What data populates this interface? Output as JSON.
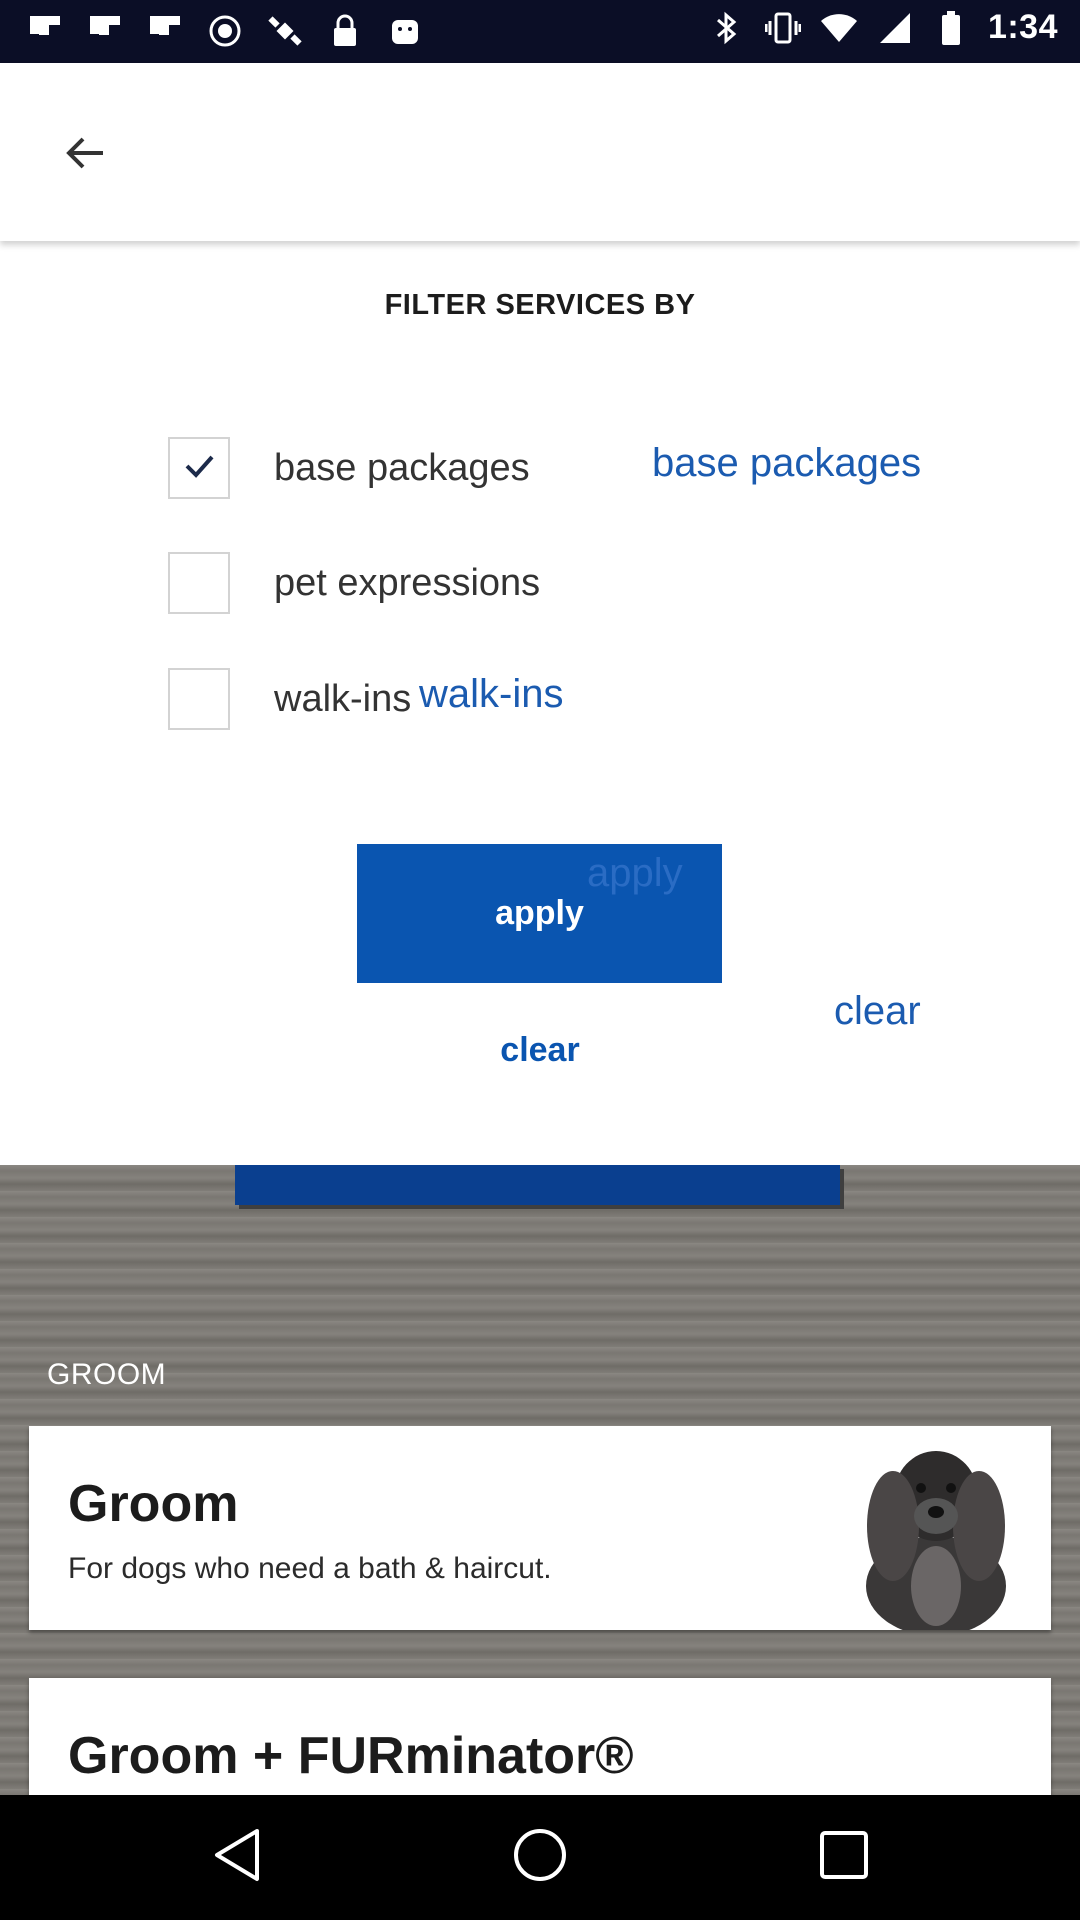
{
  "status_bar": {
    "time": "1:34",
    "icons": [
      "flipboard-icon",
      "flipboard-icon",
      "flipboard-icon",
      "circle-icon",
      "satellite-icon",
      "lock-icon",
      "android-icon",
      "bluetooth-icon",
      "vibrate-icon",
      "wifi-icon",
      "signal-icon",
      "battery-icon"
    ]
  },
  "app_bar": {
    "back_icon": "arrow-left-icon"
  },
  "filter": {
    "title": "FILTER SERVICES BY",
    "options": [
      {
        "label": "base packages",
        "checked": true,
        "overlay": "base packages"
      },
      {
        "label": "pet expressions",
        "checked": false
      },
      {
        "label": "walk-ins",
        "checked": false,
        "overlay": "walk-ins"
      }
    ],
    "apply_label": "apply",
    "apply_overlay": "apply",
    "clear_label": "clear",
    "clear_overlay": "clear"
  },
  "background": {
    "section_label": "GROOM",
    "cards": [
      {
        "title": "Groom",
        "description": "For dogs who need a bath & haircut."
      },
      {
        "title": "Groom + FURminator®"
      }
    ]
  },
  "nav_bar": {
    "icons": [
      "back-triangle-icon",
      "home-circle-icon",
      "recents-square-icon"
    ]
  },
  "colors": {
    "accent": "#0a55b0",
    "status_bar": "#0b0e26"
  }
}
